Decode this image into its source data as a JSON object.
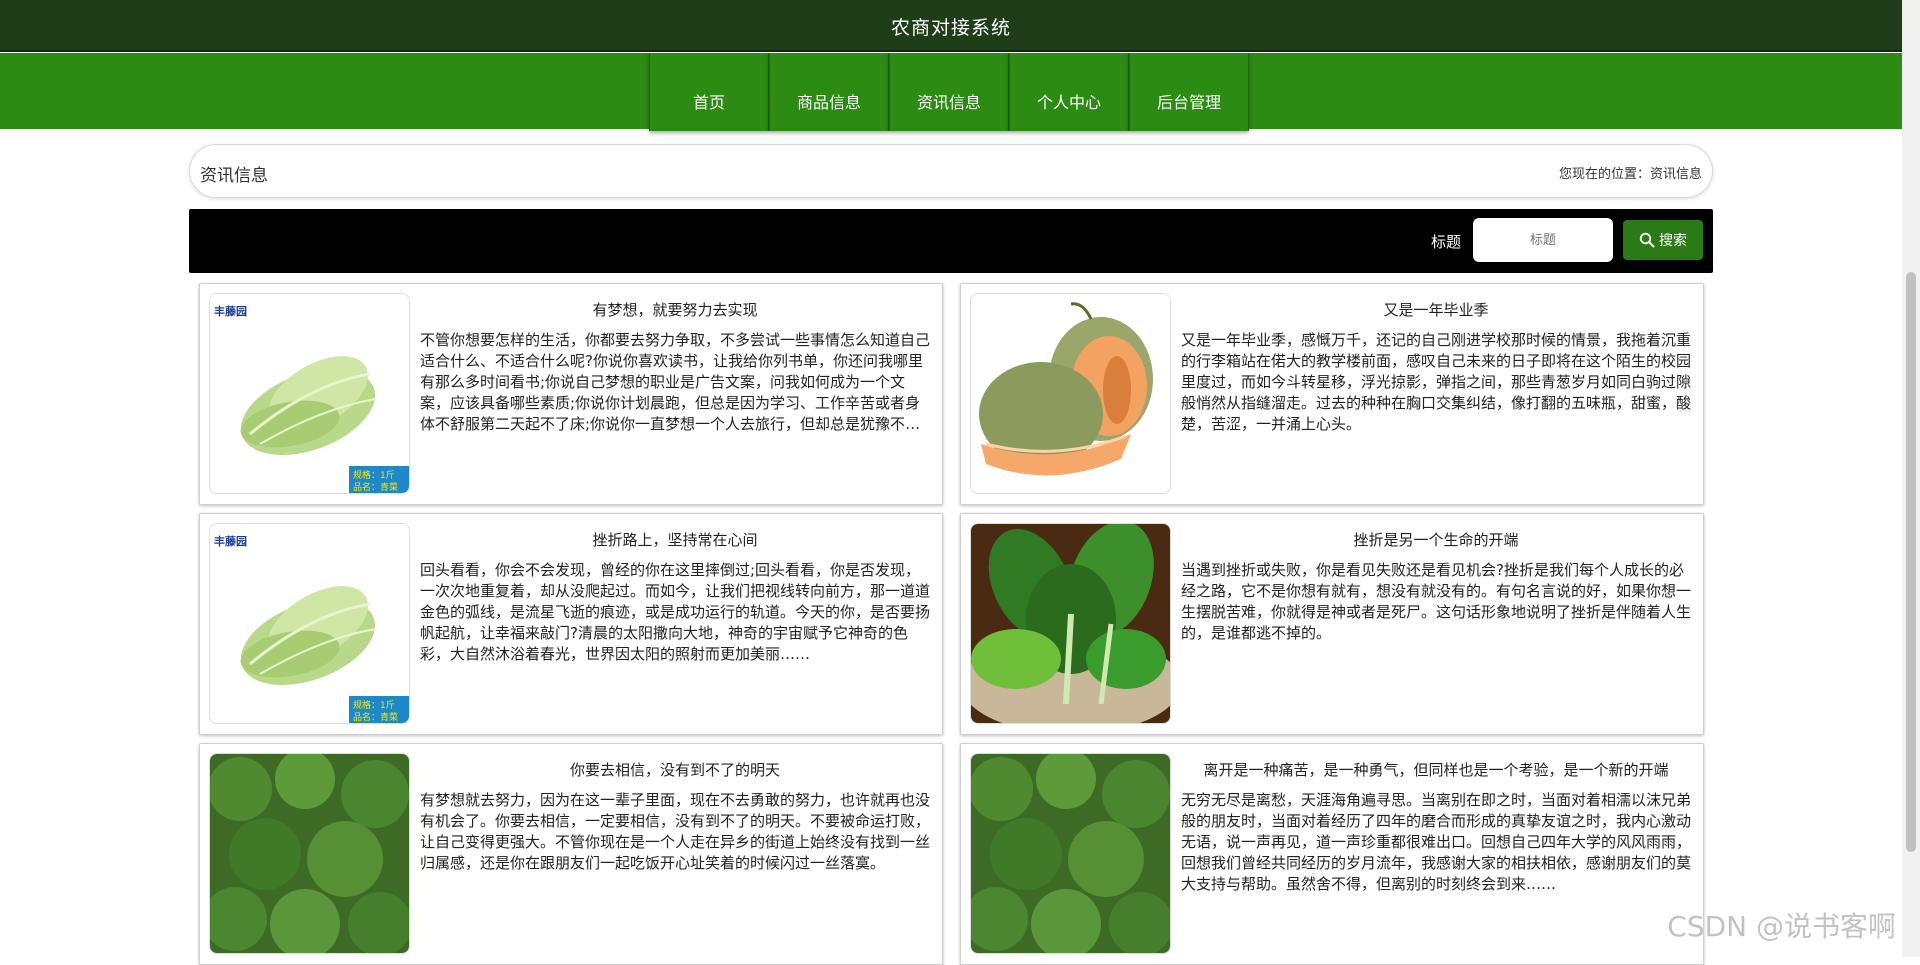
{
  "header": {
    "title": "农商对接系统"
  },
  "nav": {
    "items": [
      "首页",
      "商品信息",
      "资讯信息",
      "个人中心",
      "后台管理"
    ]
  },
  "breadcrumb": {
    "page_name": "资讯信息",
    "location": "您现在的位置：资讯信息"
  },
  "search": {
    "label": "标题",
    "placeholder": "标题",
    "button_label": "搜索"
  },
  "articles": [
    {
      "title": "有梦想，就要努力去实现",
      "image": "lettuce",
      "badge_lines": [
        "规格：1斤",
        "品名：青菜"
      ],
      "summary": "不管你想要怎样的生活，你都要去努力争取，不多尝试一些事情怎么知道自己适合什么、不适合什么呢?你说你喜欢读书，让我给你列书单，你还问我哪里有那么多时间看书;你说自己梦想的职业是广告文案，问我如何成为一个文案，应该具备哪些素质;你说你计划晨跑，但总是因为学习、工作辛苦或者身体不舒服第二天起不了床;你说你一直梦想一个人去旅行，但却总是犹豫不决……"
    },
    {
      "title": "又是一年毕业季",
      "image": "melon",
      "summary": "又是一年毕业季，感慨万千，还记的自己刚进学校那时候的情景，我拖着沉重的行李箱站在偌大的教学楼前面，感叹自己未来的日子即将在这个陌生的校园里度过，而如今斗转星移，浮光掠影，弹指之间，那些青葱岁月如同白驹过隙般悄然从指缝溜走。过去的种种在胸口交集纠结，像打翻的五味瓶，甜蜜，酸楚，苦涩，一并涌上心头。"
    },
    {
      "title": "挫折路上，坚持常在心间",
      "image": "lettuce",
      "badge_lines": [
        "规格：1斤",
        "品名：青菜"
      ],
      "summary": "回头看看，你会不会发现，曾经的你在这里摔倒过;回头看看，你是否发现，一次次地重复着，却从没爬起过。而如今，让我们把视线转向前方，那一道道金色的弧线，是流星飞逝的痕迹，或是成功运行的轨道。今天的你，是否要扬帆起航，让幸福来敲门?清晨的太阳撒向大地，神奇的宇宙赋予它神奇的色彩，大自然沐浴着春光，世界因太阳的照射而更加美丽……"
    },
    {
      "title": "挫折是另一个生命的开端",
      "image": "greens",
      "summary": "当遇到挫折或失败，你是看见失败还是看见机会?挫折是我们每个人成长的必经之路，它不是你想有就有，想没有就没有的。有句名言说的好，如果你想一生摆脱苦难，你就得是神或者是死尸。这句话形象地说明了挫折是伴随着人生的，是谁都逃不掉的。"
    },
    {
      "title": "你要去相信，没有到不了的明天",
      "image": "broccoli",
      "summary": "有梦想就去努力，因为在这一辈子里面，现在不去勇敢的努力，也许就再也没有机会了。你要去相信，一定要相信，没有到不了的明天。不要被命运打败，让自己变得更强大。不管你现在是一个人走在异乡的街道上始终没有找到一丝归属感，还是你在跟朋友们一起吃饭开心址笑着的时候闪过一丝落寞。"
    },
    {
      "title": "离开是一种痛苦，是一种勇气，但同样也是一个考验，是一个新的开端",
      "image": "broccoli",
      "summary": "无穷无尽是离愁，天涯海角遍寻思。当离别在即之时，当面对着相濡以沫兄弟般的朋友时，当面对着经历了四年的磨合而形成的真挚友谊之时，我内心激动无语，说一声再见，道一声珍重都很难出口。回想自己四年大学的风风雨雨，回想我们曾经共同经历的岁月流年，我感谢大家的相扶相依，感谢朋友们的莫大支持与帮助。虽然舍不得，但离别的时刻终会到来……"
    }
  ],
  "brand_logo": "丰藤园",
  "watermark": "CSDN @说书客啊",
  "colors": {
    "header_bg": "#1f3d18",
    "nav_bg": "#2b8b12",
    "search_bar_bg": "#000000",
    "search_button_bg": "#2a7a16"
  }
}
